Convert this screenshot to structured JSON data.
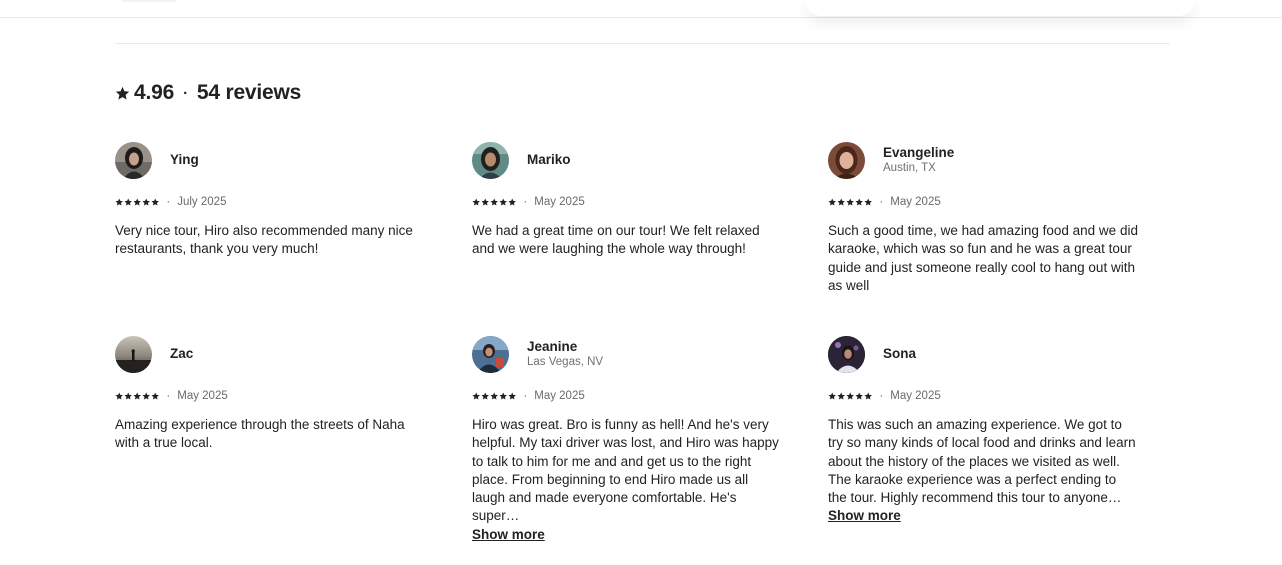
{
  "summary": {
    "rating": "4.96",
    "separator": "·",
    "reviews_count": "54 reviews"
  },
  "reviews": [
    {
      "name": "Ying",
      "location": "",
      "stars": 5,
      "date": "July 2025",
      "text": "Very nice tour, Hiro also recommended many nice restaurants, thank you very much!",
      "show_more": ""
    },
    {
      "name": "Mariko",
      "location": "",
      "stars": 5,
      "date": "May 2025",
      "text": "We had a great time on our tour! We felt relaxed and we were laughing the whole way through!",
      "show_more": ""
    },
    {
      "name": "Evangeline",
      "location": "Austin, TX",
      "stars": 5,
      "date": "May 2025",
      "text": "Such a good time, we had amazing food and we did karaoke, which was so fun and he was a great tour guide and just someone really cool to hang out with as well",
      "show_more": ""
    },
    {
      "name": "Zac",
      "location": "",
      "stars": 5,
      "date": "May 2025",
      "text": "Amazing experience through the streets of Naha with a true local.",
      "show_more": ""
    },
    {
      "name": "Jeanine",
      "location": "Las Vegas, NV",
      "stars": 5,
      "date": "May 2025",
      "text": "Hiro was great. Bro is funny as hell! And he's very helpful. My taxi driver was lost, and Hiro was happy to talk to him for me and and get us to the right place. From beginning to end Hiro made us all laugh and made everyone comfortable. He's super…",
      "show_more": "Show more"
    },
    {
      "name": "Sona",
      "location": "",
      "stars": 5,
      "date": "May 2025",
      "text": "This was such an amazing experience. We got to try so many kinds of local food and drinks and learn about the history of the places we visited as well. The karaoke experience was a perfect ending to the tour. Highly recommend this tour to anyone…",
      "show_more": "Show more"
    }
  ],
  "icons": {
    "rating_star": "star-icon",
    "review_star": "star-icon"
  },
  "colors": {
    "text": "#222222",
    "muted": "#717171",
    "divider": "#ebebeb"
  }
}
